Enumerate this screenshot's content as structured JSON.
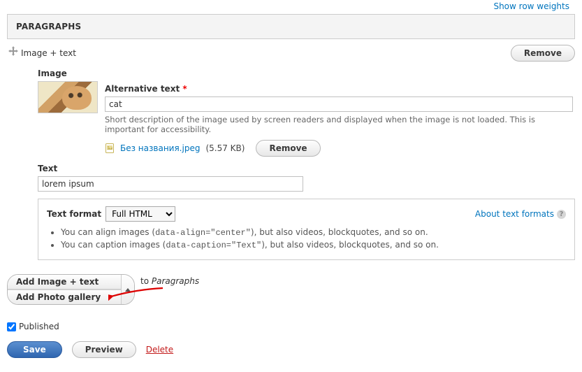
{
  "top_link": "Show row weights",
  "section_title": "PARAGRAPHS",
  "row_title": "Image + text",
  "remove_label": "Remove",
  "image_label": "Image",
  "alt": {
    "label": "Alternative text",
    "required_marker": "*",
    "value": "cat",
    "description": "Short description of the image used by screen readers and displayed when the image is not loaded. This is important for accessibility."
  },
  "file": {
    "name": "Без названия.jpeg",
    "size": "(5.57 KB)",
    "remove_label": "Remove"
  },
  "text": {
    "label": "Text",
    "value": "lorem ipsum"
  },
  "format": {
    "label": "Text format",
    "selected": "Full HTML",
    "about": "About text formats",
    "tip1_pre": "You can align images (",
    "tip1_code": "data-align=\"center\"",
    "tip1_post": "), but also videos, blockquotes, and so on.",
    "tip2_pre": "You can caption images (",
    "tip2_code": "data-caption=\"Text\"",
    "tip2_post": "), but also videos, blockquotes, and so on."
  },
  "add": {
    "option1": "Add Image + text",
    "option2": "Add Photo gallery",
    "to": "to ",
    "target": "Paragraphs"
  },
  "published": {
    "label": "Published",
    "checked": true
  },
  "actions": {
    "save": "Save",
    "preview": "Preview",
    "delete": "Delete"
  }
}
